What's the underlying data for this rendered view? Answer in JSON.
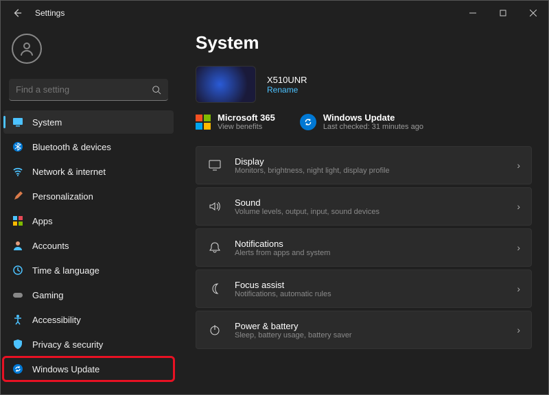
{
  "titlebar": {
    "title": "Settings"
  },
  "search": {
    "placeholder": "Find a setting"
  },
  "sidebar": {
    "items": [
      {
        "label": "System"
      },
      {
        "label": "Bluetooth & devices"
      },
      {
        "label": "Network & internet"
      },
      {
        "label": "Personalization"
      },
      {
        "label": "Apps"
      },
      {
        "label": "Accounts"
      },
      {
        "label": "Time & language"
      },
      {
        "label": "Gaming"
      },
      {
        "label": "Accessibility"
      },
      {
        "label": "Privacy & security"
      },
      {
        "label": "Windows Update"
      }
    ]
  },
  "main": {
    "heading": "System",
    "device": {
      "name": "X510UNR",
      "rename": "Rename"
    },
    "svc1": {
      "title": "Microsoft 365",
      "sub": "View benefits"
    },
    "svc2": {
      "title": "Windows Update",
      "sub": "Last checked: 31 minutes ago"
    },
    "cards": [
      {
        "title": "Display",
        "sub": "Monitors, brightness, night light, display profile"
      },
      {
        "title": "Sound",
        "sub": "Volume levels, output, input, sound devices"
      },
      {
        "title": "Notifications",
        "sub": "Alerts from apps and system"
      },
      {
        "title": "Focus assist",
        "sub": "Notifications, automatic rules"
      },
      {
        "title": "Power & battery",
        "sub": "Sleep, battery usage, battery saver"
      }
    ]
  }
}
